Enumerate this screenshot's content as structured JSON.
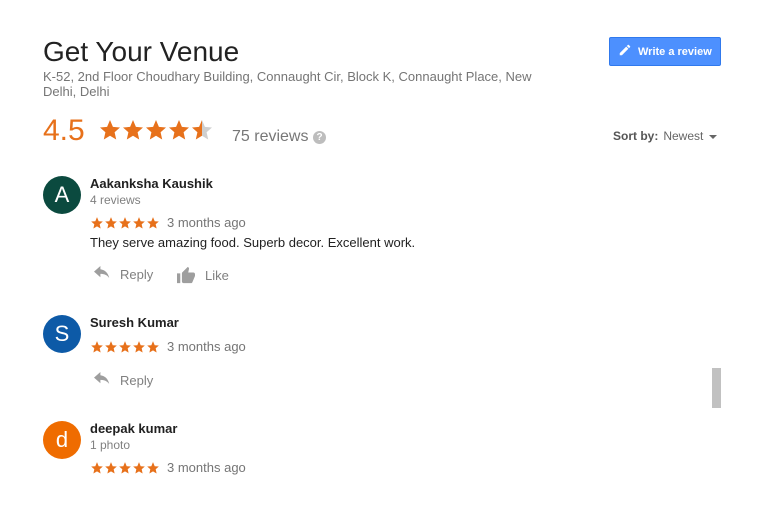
{
  "header": {
    "title": "Get Your Venue",
    "address": "K-52, 2nd Floor Choudhary Building, Connaught Cir, Block K, Connaught Place, New Delhi, Delhi",
    "write_review_label": "Write a review"
  },
  "summary": {
    "rating": "4.5",
    "stars": 4.5,
    "review_count": "75 reviews",
    "help_glyph": "?"
  },
  "sort": {
    "label": "Sort by:",
    "value": "Newest"
  },
  "colors": {
    "star": "#e7711b",
    "star_empty": "#cfcfcf",
    "button": "#4d90fe"
  },
  "reviews": [
    {
      "initial": "A",
      "avatar_color": "#0b4a3f",
      "name": "Aakanksha Kaushik",
      "meta": "4 reviews",
      "stars": 5,
      "time": "3 months ago",
      "text": "They serve amazing food. Superb decor. Excellent work.",
      "reply_label": "Reply",
      "like_label": "Like"
    },
    {
      "initial": "S",
      "avatar_color": "#0d5aa7",
      "name": "Suresh Kumar",
      "stars": 5,
      "time": "3 months ago",
      "reply_label": "Reply"
    },
    {
      "initial": "d",
      "avatar_color": "#ef6c00",
      "name": "deepak kumar",
      "meta": "1 photo",
      "stars": 5,
      "time": "3 months ago"
    }
  ]
}
